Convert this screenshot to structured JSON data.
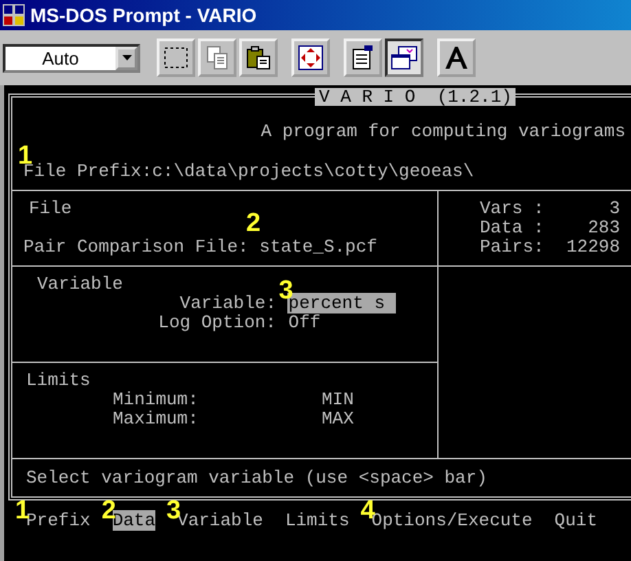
{
  "window": {
    "title": "MS-DOS Prompt - VARIO"
  },
  "toolbar": {
    "font_size": "Auto",
    "buttons": [
      {
        "kind": "mark",
        "pressed": false
      },
      {
        "kind": "copy",
        "pressed": false
      },
      {
        "kind": "paste",
        "pressed": false
      },
      {
        "kind": "fullscreen",
        "pressed": false
      },
      {
        "kind": "properties",
        "pressed": false
      },
      {
        "kind": "background",
        "pressed": true
      },
      {
        "kind": "font",
        "pressed": false
      }
    ]
  },
  "console": {
    "program_title": "V A R I O  (1.2.1)",
    "subtitle": "A program for computing variograms",
    "file_prefix": {
      "label": "File Prefix:",
      "value": "c:\\data\\projects\\cotty\\geoeas\\",
      "marker": "1"
    },
    "file_section": {
      "heading": "File",
      "label": "Pair Comparison File:",
      "value": "state_S.pcf",
      "marker": "2"
    },
    "stats": [
      {
        "label": "Vars :",
        "value": "3"
      },
      {
        "label": "Data :",
        "value": "283"
      },
      {
        "label": "Pairs:",
        "value": "12298"
      }
    ],
    "variable_section": {
      "heading": "Variable",
      "fields": [
        {
          "label": "Variable:",
          "value": "percent s",
          "selected": true,
          "marker": "3"
        },
        {
          "label": "Log Option:",
          "value": "Off",
          "selected": false
        }
      ]
    },
    "limits_section": {
      "heading": "Limits",
      "fields": [
        {
          "label": "Minimum:",
          "value": "MIN"
        },
        {
          "label": "Maximum:",
          "value": "MAX"
        }
      ]
    },
    "status": "Select variogram variable (use <space> bar)",
    "menu": [
      {
        "label": "Prefix",
        "selected": false,
        "marker": "1"
      },
      {
        "label": "Data",
        "selected": true,
        "marker": "2"
      },
      {
        "label": "Variable",
        "selected": false,
        "marker": "3"
      },
      {
        "label": "Limits",
        "selected": false
      },
      {
        "label": "Options/Execute",
        "selected": false,
        "marker": "4"
      },
      {
        "label": "Quit",
        "selected": false
      }
    ]
  }
}
